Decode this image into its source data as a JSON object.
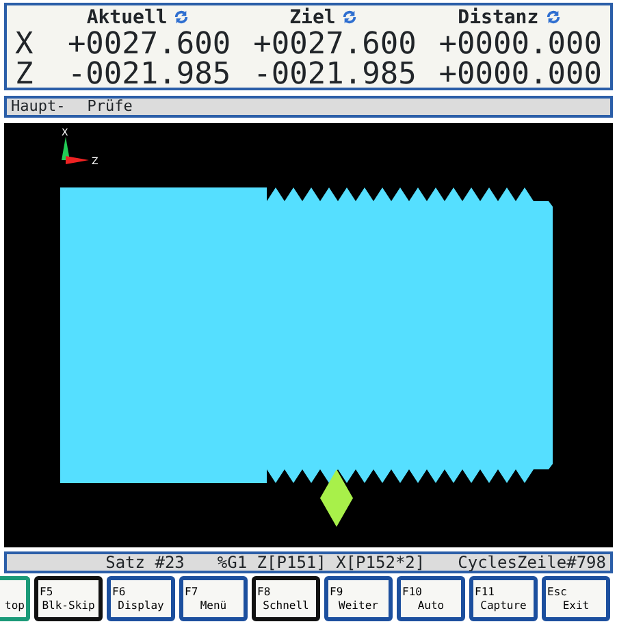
{
  "position": {
    "columns": [
      {
        "label": "Aktuell"
      },
      {
        "label": "Ziel"
      },
      {
        "label": "Distanz"
      }
    ],
    "rows": [
      {
        "axis": "X",
        "values": [
          "+0027.600",
          "+0027.600",
          "+0000.000"
        ]
      },
      {
        "axis": "Z",
        "values": [
          "-0021.985",
          "-0021.985",
          "+0000.000"
        ]
      }
    ]
  },
  "axis_indicator": {
    "x_label": "X",
    "z_label": "Z"
  },
  "mode_bar": [
    "Haupt-",
    "Prüfe"
  ],
  "status_bar": [
    "Satz #23",
    "%G1 Z[P151] X[P152*2]",
    "CyclesZeile#798"
  ],
  "softkeys": [
    {
      "label": "top",
      "color": "#1b9a78"
    },
    {
      "key": "F5",
      "label": "Blk-Skip",
      "color": "#111111"
    },
    {
      "key": "F6",
      "label": "Display",
      "color": "#1c4f9e"
    },
    {
      "key": "F7",
      "label": "Menü",
      "color": "#1c4f9e"
    },
    {
      "key": "F8",
      "label": "Schnell",
      "color": "#111111"
    },
    {
      "key": "F9",
      "label": "Weiter",
      "color": "#1c4f9e"
    },
    {
      "key": "F10",
      "label": "Auto",
      "color": "#1c4f9e"
    },
    {
      "key": "F11",
      "label": "Capture",
      "color": "#1c4f9e"
    },
    {
      "key": "Esc",
      "label": "Exit",
      "color": "#1c4f9e"
    }
  ]
}
